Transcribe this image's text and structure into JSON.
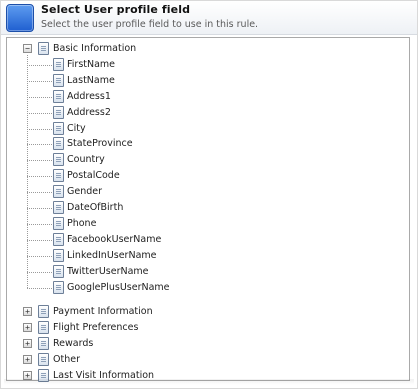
{
  "header": {
    "title": "Select User profile field",
    "subtitle": "Select the user profile field to use in this rule."
  },
  "tree": {
    "root": {
      "label": "Basic Information",
      "expanded": true,
      "toggle": "−",
      "children": [
        "FirstName",
        "LastName",
        "Address1",
        "Address2",
        "City",
        "StateProvince",
        "Country",
        "PostalCode",
        "Gender",
        "DateOfBirth",
        "Phone",
        "FacebookUserName",
        "LinkedInUserName",
        "TwitterUserName",
        "GooglePlusUserName"
      ]
    },
    "collapsed": [
      {
        "label": "Payment Information",
        "toggle": "+"
      },
      {
        "label": "Flight Preferences",
        "toggle": "+"
      },
      {
        "label": "Rewards",
        "toggle": "+"
      },
      {
        "label": "Other",
        "toggle": "+"
      },
      {
        "label": "Last Visit Information",
        "toggle": "+"
      }
    ]
  },
  "colors": {
    "header_icon": "#2d6fe0",
    "panel_border": "#a9a9a9"
  }
}
